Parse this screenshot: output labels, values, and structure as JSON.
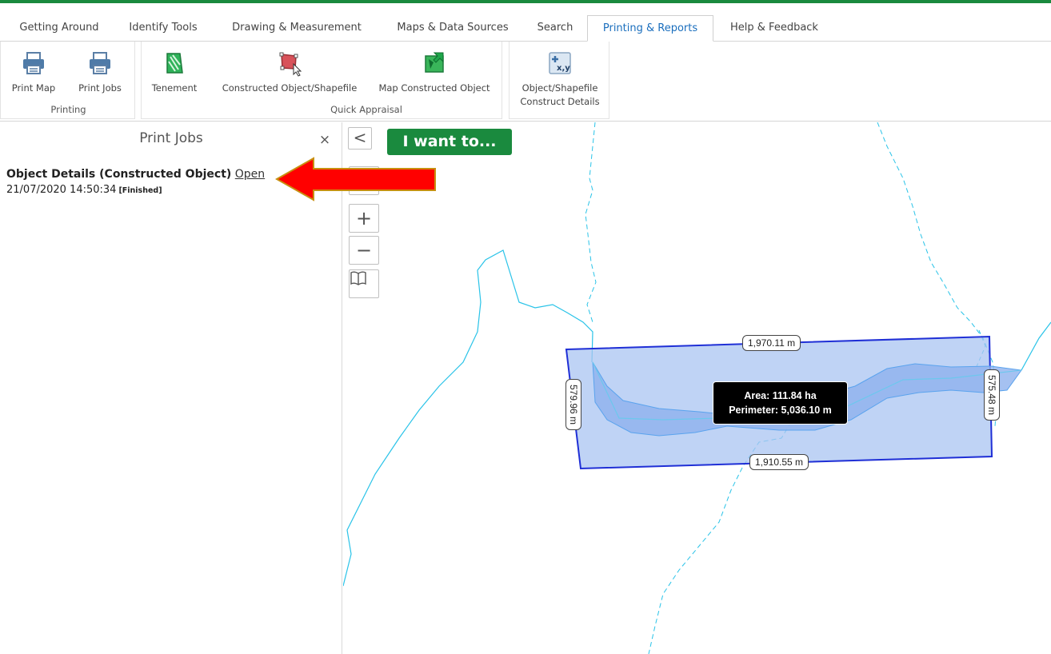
{
  "tabs": [
    {
      "label": "Getting Around"
    },
    {
      "label": "Identify Tools"
    },
    {
      "label": "Drawing & Measurement"
    },
    {
      "label": "Maps & Data Sources"
    },
    {
      "label": "Search"
    },
    {
      "label": "Printing & Reports"
    },
    {
      "label": "Help & Feedback"
    }
  ],
  "active_tab": "Printing & Reports",
  "ribbon": {
    "printing": {
      "group_label": "Printing",
      "print_map": "Print Map",
      "print_jobs": "Print Jobs"
    },
    "quick_appraisal": {
      "group_label": "Quick Appraisal",
      "tenement": "Tenement",
      "constructed_object": "Constructed Object/Shapefile",
      "map_constructed": "Map Constructed Object"
    },
    "construct_details": {
      "label_line1": "Object/Shapefile",
      "label_line2": "Construct Details"
    }
  },
  "panel": {
    "title": "Print Jobs",
    "close": "×",
    "job": {
      "title": "Object Details (Constructed Object)",
      "open_link": "Open",
      "date": "21/07/2020 14:50:34",
      "status": "[Finished]"
    }
  },
  "map": {
    "collapse": "<",
    "i_want_to": "I want to...",
    "zoom_in": "+",
    "zoom_out": "−",
    "measurements": {
      "top": "1,970.11 m",
      "bottom": "1,910.55 m",
      "left": "579.96 m",
      "right": "575.48 m"
    },
    "tooltip": {
      "area": "Area: 111.84 ha",
      "perimeter": "Perimeter: 5,036.10 m"
    }
  },
  "colors": {
    "accent_green": "#1a8a3e",
    "active_tab_text": "#1a6ebd",
    "polygon_stroke": "#1f2fd6",
    "polygon_fill": "#aac4f2",
    "river": "#29c3e8",
    "arrow_red": "#ff0000"
  }
}
